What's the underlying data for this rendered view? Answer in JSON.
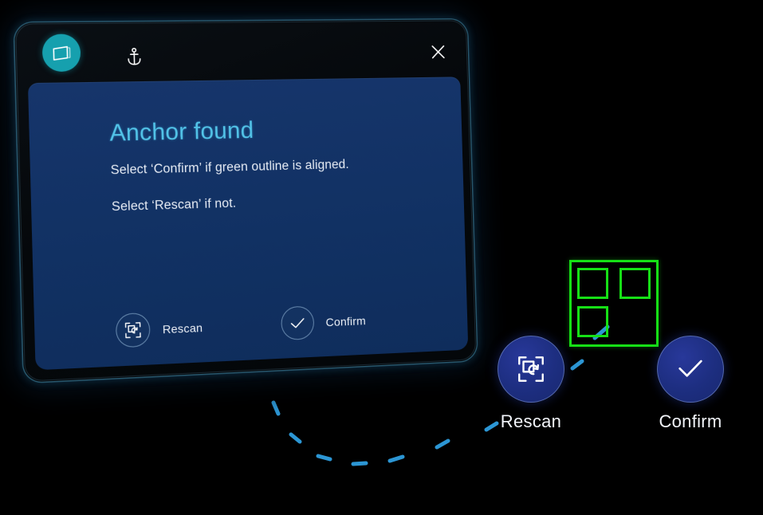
{
  "scene": {
    "background_color": "#000000",
    "accent_color": "#52c3e8",
    "panel_color": "#123264",
    "button_color": "#1d2e80",
    "marker_color": "#16e016",
    "app_chip_color": "#16a0ae",
    "trail_color": "#2f9fe0"
  },
  "dialog": {
    "titlebar": {
      "app_icon": "slate-window-icon",
      "anchor_icon": "anchor-icon",
      "close_icon": "close-icon"
    },
    "title": "Anchor found",
    "body_line_1": "Select ‘Confirm’ if green outline is aligned.",
    "body_line_2": "Select ‘Rescan’ if not.",
    "actions": [
      {
        "id": "rescan",
        "label": "Rescan",
        "icon": "rescan-frame-refresh-icon"
      },
      {
        "id": "confirm",
        "label": "Confirm",
        "icon": "checkmark-icon"
      }
    ]
  },
  "hand_menu": {
    "buttons": [
      {
        "id": "rescan",
        "label": "Rescan",
        "icon": "rescan-frame-refresh-icon"
      },
      {
        "id": "confirm",
        "label": "Confirm",
        "icon": "checkmark-icon"
      }
    ]
  },
  "marker": {
    "name": "green-anchor-outline",
    "finder_squares": 3
  }
}
